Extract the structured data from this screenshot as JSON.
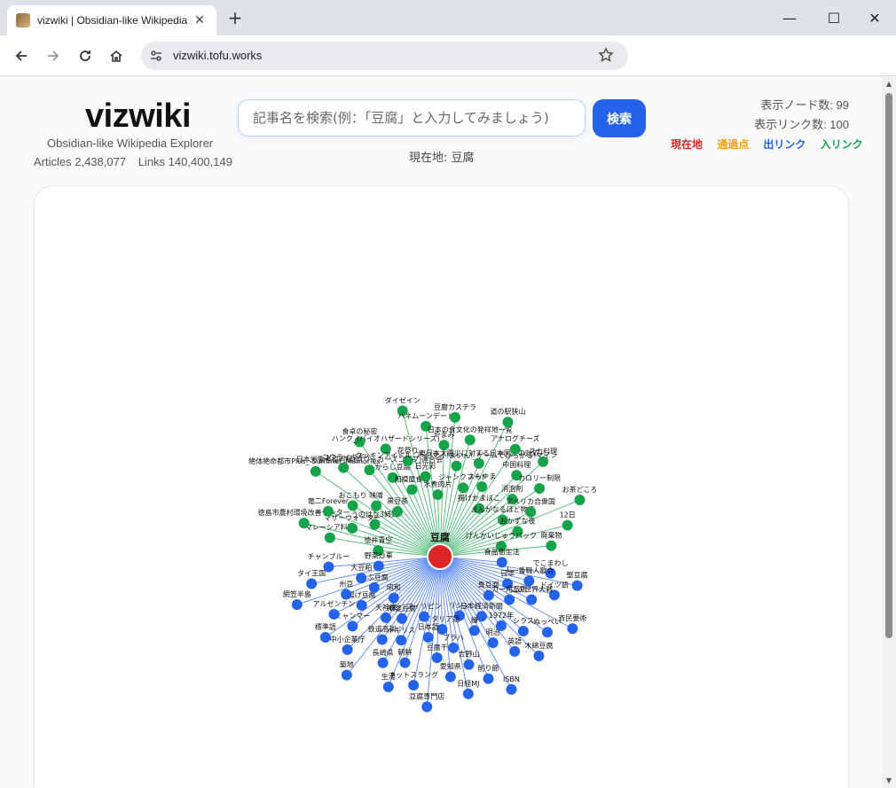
{
  "browser": {
    "tab_title": "vizwiki | Obsidian-like Wikipedia",
    "url": "vizwiki.tofu.works"
  },
  "header": {
    "logo": "vizwiki",
    "subtitle": "Obsidian-like Wikipedia Explorer",
    "articles": "Articles 2,438,077",
    "links": "Links 140,400,149"
  },
  "search": {
    "placeholder": "記事名を検索(例：「豆腐」と入力してみましょう)",
    "button_label": "検索",
    "current_location": "現在地: 豆腐"
  },
  "counts": {
    "nodes": "表示ノード数: 99",
    "links": "表示リンク数: 100"
  },
  "legend": [
    {
      "label": "現在地",
      "color": "#dc2626"
    },
    {
      "label": "通過点",
      "color": "#f59e0b"
    },
    {
      "label": "出リンク",
      "color": "#2563eb"
    },
    {
      "label": "入リンク",
      "color": "#16a34a"
    }
  ],
  "graph": {
    "center": {
      "label": "豆腐",
      "color": "#dc2626"
    },
    "in_color": "#16a34a",
    "out_color": "#2563eb",
    "in_nodes": [
      "徳井青空",
      "マレーシア料理",
      "徳島市農村環境改善センター",
      "マザーウォーター",
      "竜二Forever",
      "うのはな3姉妹",
      "おこもり",
      "絶体絶命都市Plus_-Summer_Memories-",
      "味噌",
      "コウライギギ",
      "黒豆茶",
      "日本労働者協同組合(ワーカーズコープ)連合会",
      "食卓の秘密",
      "からし豆腐",
      "ハンク_(バイオハザードシリーズ)",
      "相模屋食料",
      "花祭り",
      "ダイゼイン",
      "日光彩",
      "ハネムーンデート",
      "水煮肉片",
      "やまみ",
      "豆腐カステラ",
      "クッキンアイドル_アイ!マイ!まいん!_ゲームでひろがる!マイン",
      "日本の食文化の発祥地一覧",
      "ジャンクフード",
      "東日本大震災に対する日本国外の対応",
      "道の駅狭山",
      "よもやま",
      "アナログチーズ",
      "揚げかまぼこ",
      "中国料理",
      "スカ料理",
      "消泡剤",
      "カロリー制限",
      "まんがなるほど物語",
      "アメリカ合衆国",
      "お茶どころ",
      "おかずな夜",
      "12日",
      "げんかいじゅうパック",
      "廃棄物"
    ],
    "out_nodes": [
      "食品衛生法",
      "でこまわし",
      "堅豆腐",
      "十一番職人歌合",
      "ドイツ語",
      "日本",
      "二次世界大戦",
      "斉民要術",
      "カー用品店",
      "ぬっぺい",
      "臭豆腐",
      "シラス",
      "木綿豆腐",
      "1972年",
      "英語",
      "日本経済新聞",
      "明治",
      "ISBN",
      "鐘",
      "削り節",
      "リシン",
      "吉野山",
      "日経MJ",
      "ブラハ",
      "愛知県",
      "イタリア語",
      "豆腐干",
      "豆腐専門店",
      "日本語",
      "ネットスラング",
      "フィリピン",
      "朝鮮",
      "生湯",
      "イギリス",
      "長崎県",
      "麻婆豆腐",
      "鉄道高架",
      "築地",
      "天神様",
      "中小企業庁",
      "昭和",
      "ミャンマー",
      "標準語",
      "揚げ豆腐",
      "アルゼンチン",
      "つぶ豆腐",
      "州豆",
      "網笠半島",
      "大豆粕",
      "タイ王国",
      "野菜炒車",
      "チャンプルー"
    ]
  }
}
